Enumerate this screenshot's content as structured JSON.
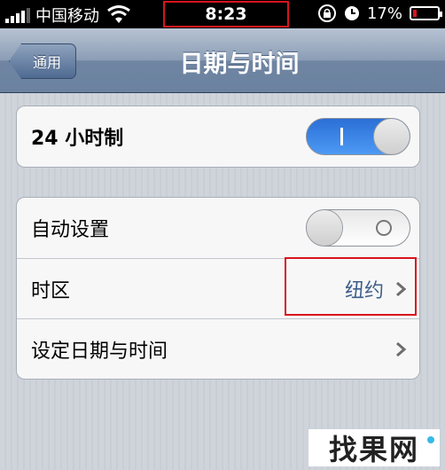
{
  "status_bar": {
    "carrier": "中国移动",
    "time": "8:23",
    "battery_percent": "17%",
    "battery_level": 0.17,
    "icons": [
      "signal-icon",
      "wifi-icon",
      "rotation-lock-icon",
      "alarm-icon",
      "battery-icon"
    ]
  },
  "navbar": {
    "back_label": "通用",
    "title": "日期与时间"
  },
  "group1": {
    "rows": [
      {
        "label": "24 小时制",
        "switch_state": "on"
      }
    ]
  },
  "group2": {
    "rows": [
      {
        "label": "自动设置",
        "switch_state": "off"
      },
      {
        "label": "时区",
        "value": "纽约"
      },
      {
        "label": "设定日期与时间"
      }
    ]
  },
  "watermark": "找果网",
  "colors": {
    "accent_blue": "#3b82e8",
    "highlight_red": "#d8141c",
    "detail_text": "#3f5e8c"
  }
}
